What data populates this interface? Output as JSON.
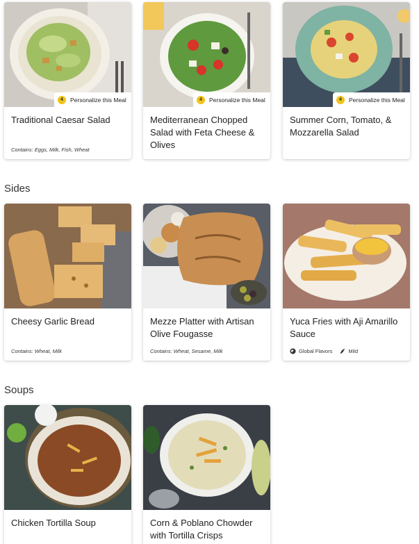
{
  "personalize_label": "Personalize this Meal",
  "personalize_count": "4",
  "salads": [
    {
      "title": "Traditional Caesar Salad",
      "contains": "Contains: Eggs, Milk, Fish, Wheat"
    },
    {
      "title": "Mediterranean Chopped Salad with Feta Cheese & Olives",
      "contains": ""
    },
    {
      "title": "Summer Corn, Tomato, & Mozzarella Salad",
      "contains": ""
    }
  ],
  "sections": {
    "sides": "Sides",
    "soups": "Soups"
  },
  "sides": [
    {
      "title": "Cheesy Garlic Bread",
      "contains": "Contains: Wheat, Milk"
    },
    {
      "title": "Mezze Platter with Artisan Olive Fougasse",
      "contains": "Contains: Wheat, Sesame, Milk"
    },
    {
      "title": "Yuca Fries with Aji Amarillo Sauce",
      "tags": [
        "Global Flavors",
        "Mild"
      ]
    }
  ],
  "soups": [
    {
      "title": "Chicken Tortilla Soup"
    },
    {
      "title": "Corn & Poblano Chowder with Tortilla Crisps"
    }
  ],
  "colors": {
    "badge": "#f0c419"
  }
}
